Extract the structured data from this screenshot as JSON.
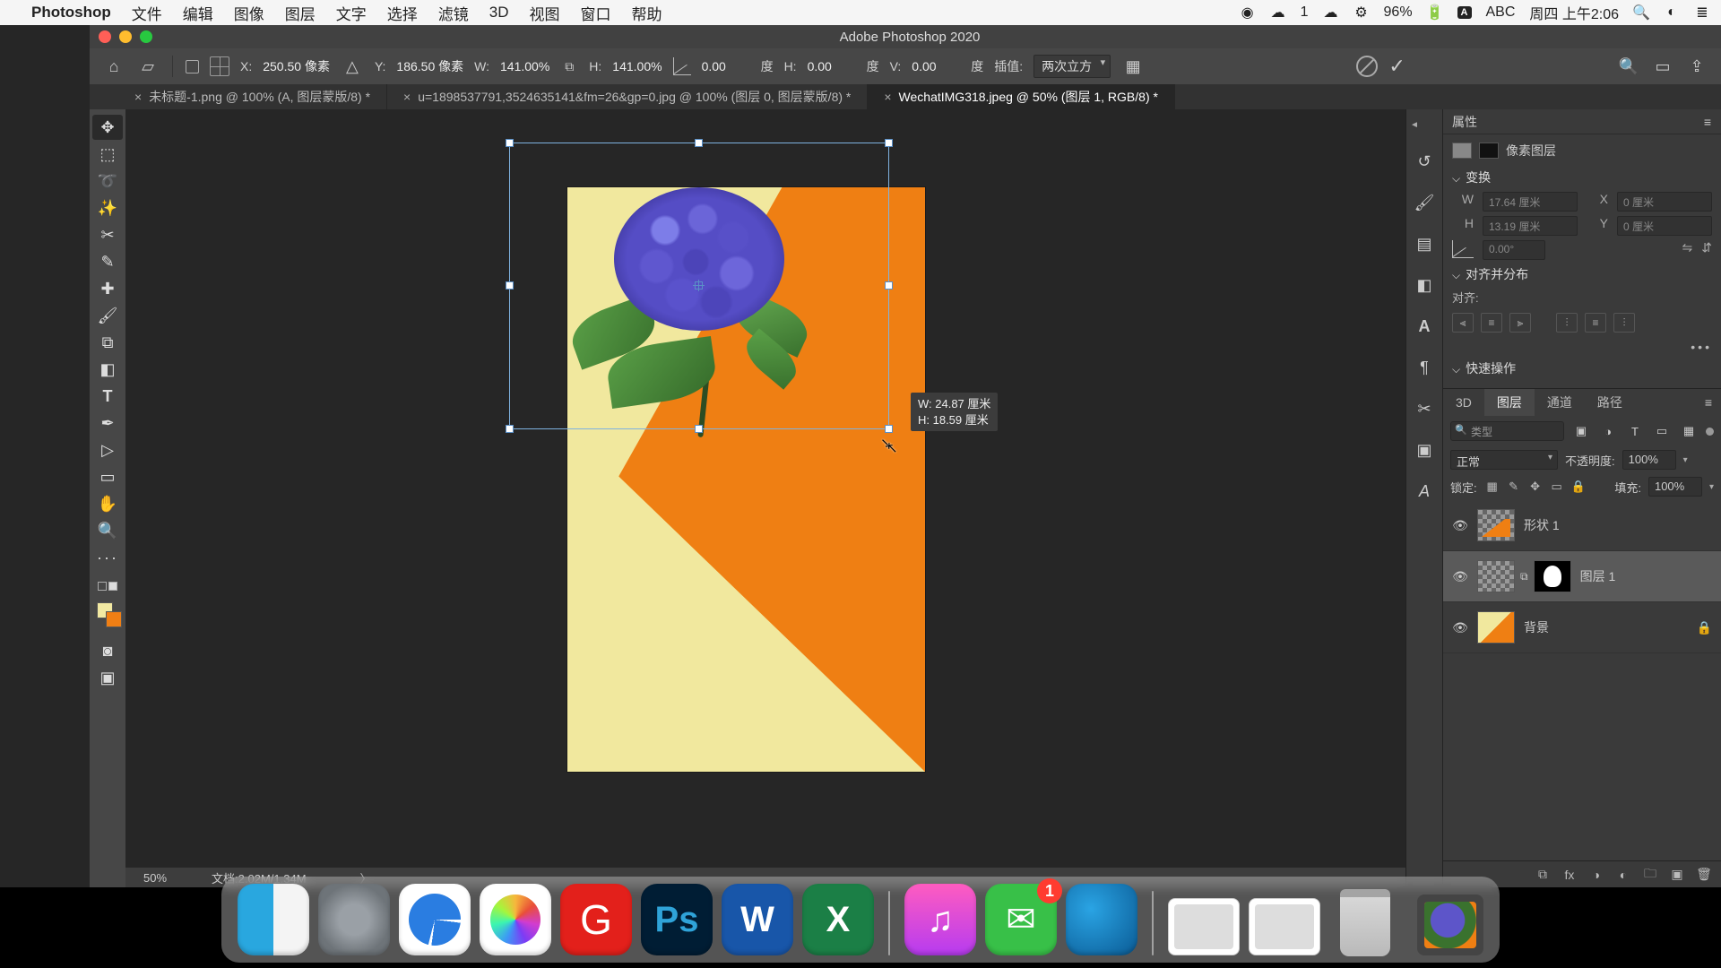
{
  "mac_menubar": {
    "app_name": "Photoshop",
    "menus": [
      "文件",
      "编辑",
      "图像",
      "图层",
      "文字",
      "选择",
      "滤镜",
      "3D",
      "视图",
      "窗口",
      "帮助"
    ],
    "battery": "96%",
    "input_abc": "ABC",
    "notify_count": "1",
    "date_time": "周四 上午2:06"
  },
  "window": {
    "title": "Adobe Photoshop 2020"
  },
  "options_bar": {
    "x_label": "X:",
    "x_value": "250.50 像素",
    "y_label": "Y:",
    "y_value": "186.50 像素",
    "w_label": "W:",
    "w_value": "141.00%",
    "h_label": "H:",
    "h_value": "141.00%",
    "angle_value": "0.00",
    "angle_unit": "度",
    "h2_label": "H:",
    "h2_value": "0.00",
    "h2_unit": "度",
    "v_label": "V:",
    "v_value": "0.00",
    "v_unit": "度",
    "interp_label": "插值:",
    "interp_value": "两次立方"
  },
  "tabs": [
    {
      "label": "未标题-1.png @ 100% (A, 图层蒙版/8) *",
      "active": false
    },
    {
      "label": "u=1898537791,3524635141&fm=26&gp=0.jpg @ 100% (图层 0, 图层蒙版/8) *",
      "active": false
    },
    {
      "label": "WechatIMG318.jpeg @ 50% (图层 1, RGB/8) *",
      "active": true
    }
  ],
  "canvas": {
    "dim_tip_w": "W: 24.87 厘米",
    "dim_tip_h": "H: 18.59 厘米"
  },
  "status": {
    "zoom": "50%",
    "docinfo": "文档:2.02M/1.34M"
  },
  "panel_strip": {
    "icons": [
      "history",
      "brush",
      "swatches",
      "adjust",
      "glyphs",
      "paragraph",
      "styles",
      "libraries",
      "char-styles"
    ]
  },
  "props_panel": {
    "title": "属性",
    "kind_label": "像素图层",
    "section_transform": "变换",
    "w_lab": "W",
    "w_val": "17.64 厘米",
    "x_lab": "X",
    "x_val": "0 厘米",
    "h_lab": "H",
    "h_val": "13.19 厘米",
    "y_lab": "Y",
    "y_val": "0 厘米",
    "rot_val": "0.00°",
    "section_align": "对齐并分布",
    "align_label": "对齐:",
    "section_quick": "快速操作"
  },
  "layers_panel": {
    "tabs": [
      "3D",
      "图层",
      "通道",
      "路径"
    ],
    "active_tab": "图层",
    "search_placeholder": "类型",
    "blend_label": "正常",
    "opacity_label": "不透明度:",
    "opacity_val": "100%",
    "lock_label": "锁定:",
    "fill_label": "填充:",
    "fill_val": "100%",
    "layers": [
      {
        "name": "形状 1",
        "selected": false,
        "locked": false,
        "kind": "shape"
      },
      {
        "name": "图层 1",
        "selected": true,
        "locked": false,
        "kind": "pixel-mask"
      },
      {
        "name": "背景",
        "selected": false,
        "locked": true,
        "kind": "bg"
      }
    ]
  },
  "dock": {
    "wechat_badge": "1"
  }
}
